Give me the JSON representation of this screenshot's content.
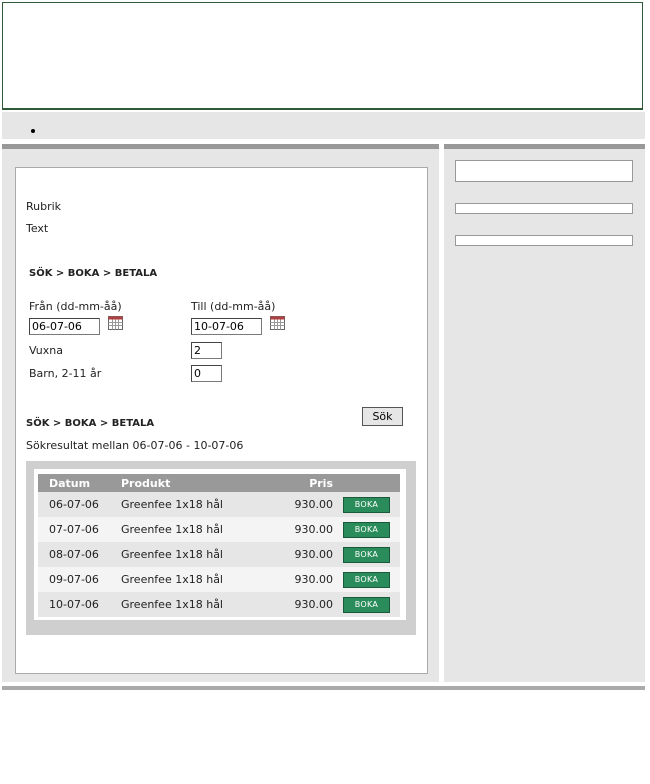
{
  "content": {
    "heading": "Rubrik",
    "text": "Text",
    "steps_top": "SÖK > BOKA > BETALA",
    "steps_bottom": "SÖK > BOKA > BETALA",
    "results_caption": "Sökresultat mellan 06-07-06 - 10-07-06"
  },
  "search_form": {
    "from_label": "Från (dd-mm-åå)",
    "from_value": "06-07-06",
    "to_label": "Till (dd-mm-åå)",
    "to_value": "10-07-06",
    "adults_label": "Vuxna",
    "adults_value": "2",
    "children_label": "Barn, 2-11 år",
    "children_value": "0",
    "search_button": "Sök"
  },
  "results": {
    "columns": [
      "Datum",
      "Produkt",
      "Pris"
    ],
    "book_label": "BOKA",
    "rows": [
      {
        "date": "06-07-06",
        "product": "Greenfee 1x18 hål",
        "price": "930.00"
      },
      {
        "date": "07-07-06",
        "product": "Greenfee 1x18 hål",
        "price": "930.00"
      },
      {
        "date": "08-07-06",
        "product": "Greenfee 1x18 hål",
        "price": "930.00"
      },
      {
        "date": "09-07-06",
        "product": "Greenfee 1x18 hål",
        "price": "930.00"
      },
      {
        "date": "10-07-06",
        "product": "Greenfee 1x18 hål",
        "price": "930.00"
      }
    ]
  },
  "icons": {
    "calendar": "calendar-icon"
  },
  "colors": {
    "book_button": "#2a8c5a",
    "header_border": "#2e5a3a",
    "panel_gray": "#e6e6e6",
    "table_header": "#999999"
  }
}
